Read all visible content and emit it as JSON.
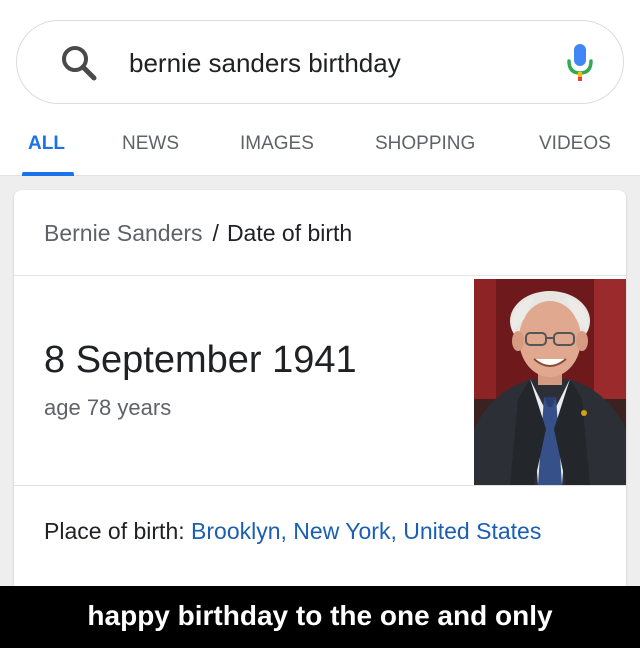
{
  "search": {
    "query": "bernie sanders birthday",
    "search_icon": "search-icon",
    "mic_icon": "microphone-icon"
  },
  "tabs": [
    {
      "label": "ALL",
      "active": true
    },
    {
      "label": "NEWS",
      "active": false
    },
    {
      "label": "IMAGES",
      "active": false
    },
    {
      "label": "SHOPPING",
      "active": false
    },
    {
      "label": "VIDEOS",
      "active": false
    }
  ],
  "card": {
    "entity": "Bernie Sanders",
    "separator": "/",
    "attribute": "Date of birth",
    "answer": "8 September 1941",
    "age": "age 78 years",
    "place_label": "Place of birth: ",
    "place_value": "Brooklyn, New York, United States"
  },
  "caption": {
    "text": "happy birthday to the one and only"
  },
  "colors": {
    "accent": "#1a73e8",
    "link": "#1a5fb4",
    "text_primary": "#202124",
    "text_secondary": "#5f6368"
  }
}
